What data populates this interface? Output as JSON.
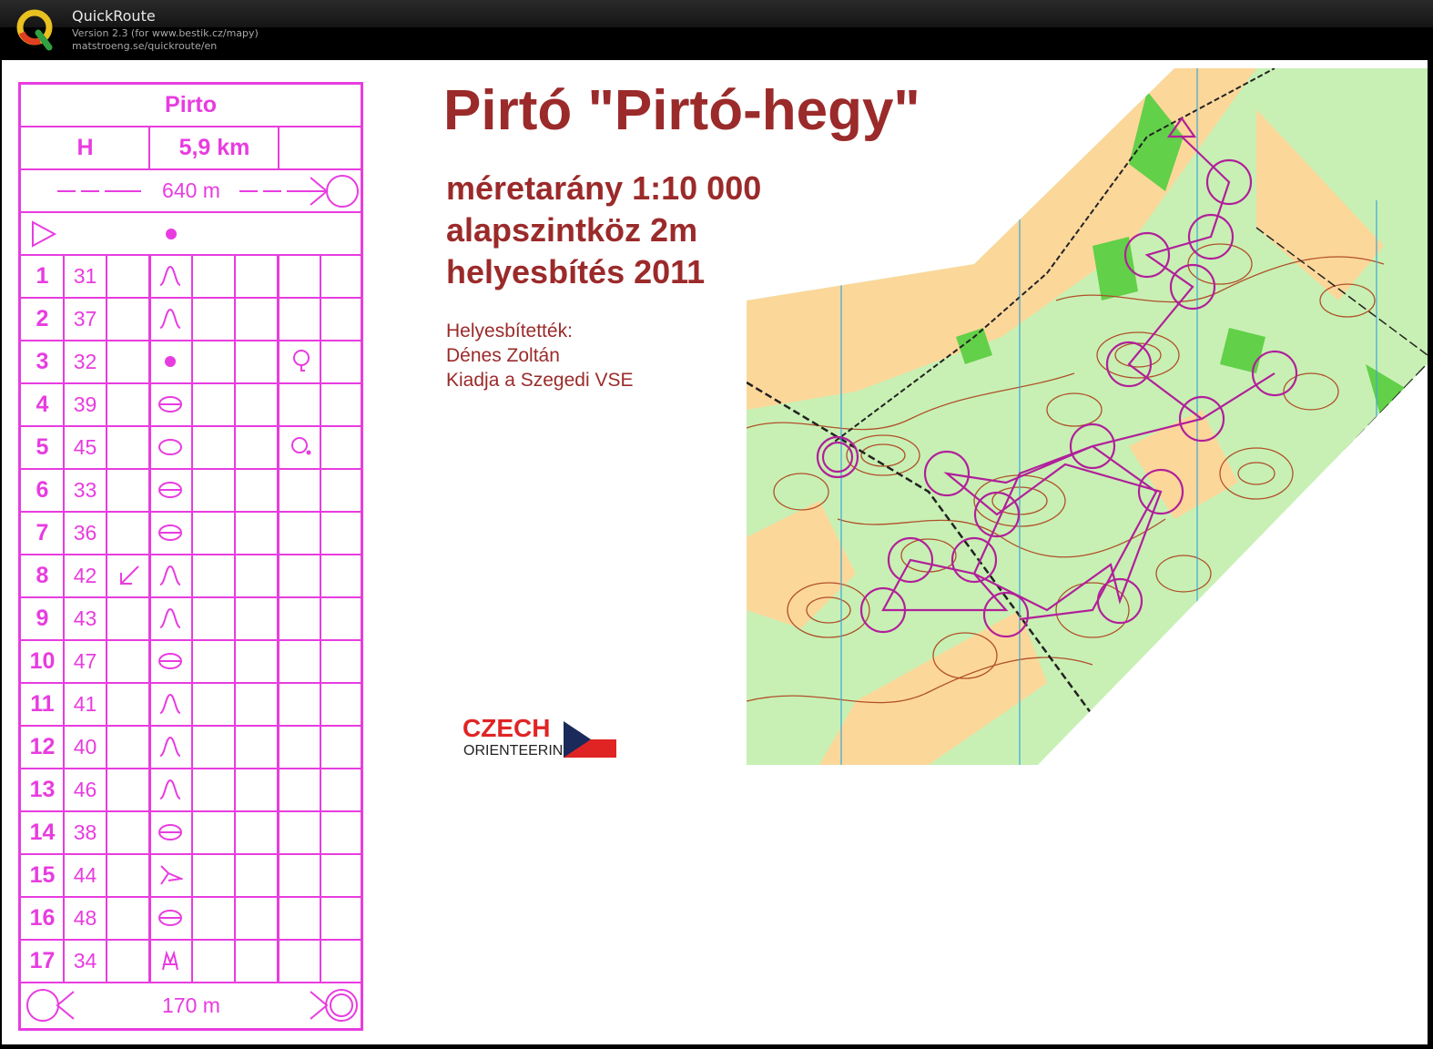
{
  "app": {
    "name": "QuickRoute",
    "version": "Version 2.3  (for www.bestik.cz/mapy)",
    "url": "matstroeng.se/quickroute/en"
  },
  "control_descriptions": {
    "event": "Pirto",
    "class": "H",
    "length": "5,9 km",
    "start_marked_route": "640 m",
    "finish_route": "170 m",
    "controls": [
      {
        "num": "1",
        "code": "31",
        "symbol": "knoll"
      },
      {
        "num": "2",
        "code": "37",
        "symbol": "knoll"
      },
      {
        "num": "3",
        "code": "32",
        "symbol": "dot"
      },
      {
        "num": "4",
        "code": "39",
        "symbol": "depression"
      },
      {
        "num": "5",
        "code": "45",
        "symbol": "oval"
      },
      {
        "num": "6",
        "code": "33",
        "symbol": "depression"
      },
      {
        "num": "7",
        "code": "36",
        "symbol": "depression"
      },
      {
        "num": "8",
        "code": "42",
        "symbol": "knoll"
      },
      {
        "num": "9",
        "code": "43",
        "symbol": "knoll"
      },
      {
        "num": "10",
        "code": "47",
        "symbol": "depression"
      },
      {
        "num": "11",
        "code": "41",
        "symbol": "knoll"
      },
      {
        "num": "12",
        "code": "40",
        "symbol": "knoll"
      },
      {
        "num": "13",
        "code": "46",
        "symbol": "knoll"
      },
      {
        "num": "14",
        "code": "38",
        "symbol": "depression"
      },
      {
        "num": "15",
        "code": "44",
        "symbol": "spur"
      },
      {
        "num": "16",
        "code": "48",
        "symbol": "depression"
      },
      {
        "num": "17",
        "code": "34",
        "symbol": "tree"
      }
    ]
  },
  "map_header": {
    "title": "Pirtó \"Pirtó-hegy\"",
    "scale": "méretarány 1:10 000",
    "contour": "alapszintköz 2m",
    "revision": "helyesbítés 2011",
    "credit_label": "Helyesbítették:",
    "credit_name": "Dénes Zoltán",
    "publisher": "Kiadja a Szegedi VSE"
  },
  "logo": {
    "line1": "CZECH",
    "line2": "ORIENTEERING"
  },
  "colors": {
    "magenta": "#e83ce0",
    "title_red": "#9b2a2a",
    "forest_green": "#c8f0b4",
    "open_yellow": "#fcd79a",
    "contour_brown": "#b0502a",
    "course_purple": "#b0209a"
  }
}
